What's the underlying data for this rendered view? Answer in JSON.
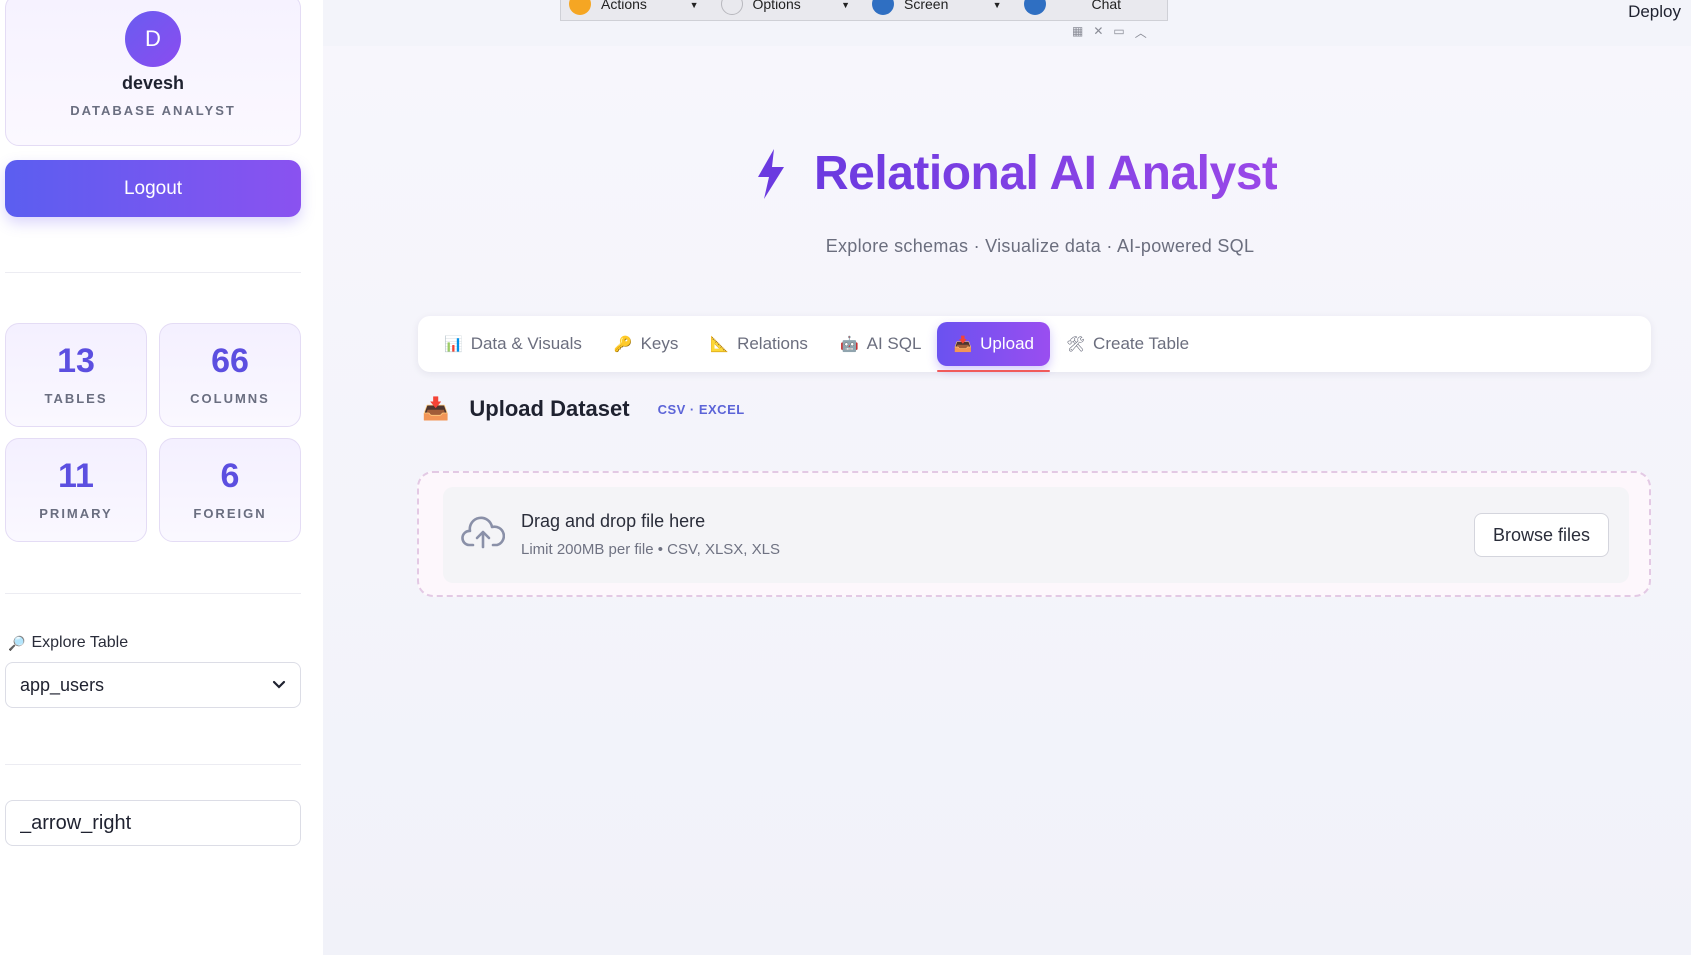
{
  "toolbar": {
    "items": [
      {
        "label": "Actions",
        "icon": "actions-icon",
        "color": "#f5a623"
      },
      {
        "label": "Options",
        "icon": "gear-icon",
        "color": "#c8c8cc"
      },
      {
        "label": "Screen",
        "icon": "screen-icon",
        "color": "#2f6fc2"
      },
      {
        "label": "Chat",
        "icon": "chat-icon",
        "color": "#2f6fc2"
      }
    ],
    "deploy_label": "Deploy"
  },
  "sidebar": {
    "profile": {
      "avatar_initial": "D",
      "name": "devesh",
      "role": "DATABASE ANALYST"
    },
    "logout_label": "Logout",
    "stats": [
      {
        "value": "13",
        "label": "TABLES"
      },
      {
        "value": "66",
        "label": "COLUMNS"
      },
      {
        "value": "11",
        "label": "PRIMARY"
      },
      {
        "value": "6",
        "label": "FOREIGN"
      }
    ],
    "explore": {
      "label": "Explore Table",
      "selected": "app_users"
    },
    "text_input_value": "_arrow_right"
  },
  "header": {
    "title": "Relational AI Analyst",
    "subtitle": "Explore schemas · Visualize data · AI-powered SQL"
  },
  "tabs": [
    {
      "label": "Data & Visuals",
      "icon": "chart-icon",
      "glyph": "📊"
    },
    {
      "label": "Keys",
      "icon": "key-icon",
      "glyph": "🔑"
    },
    {
      "label": "Relations",
      "icon": "triangle-ruler-icon",
      "glyph": "📐"
    },
    {
      "label": "AI SQL",
      "icon": "robot-icon",
      "glyph": "🤖"
    },
    {
      "label": "Upload",
      "icon": "inbox-tray-icon",
      "glyph": "📥"
    },
    {
      "label": "Create Table",
      "icon": "tools-icon",
      "glyph": "🛠"
    }
  ],
  "upload": {
    "title": "Upload Dataset",
    "badge": "CSV · EXCEL",
    "drop_title": "Drag and drop file here",
    "drop_limit": "Limit 200MB per file • CSV, XLSX, XLS",
    "browse_label": "Browse files"
  },
  "colors": {
    "accent": "#6a52f0",
    "accent_end": "#9a4ef0",
    "stat_value": "#5c4fe0",
    "active_underline": "#f05a5a"
  }
}
